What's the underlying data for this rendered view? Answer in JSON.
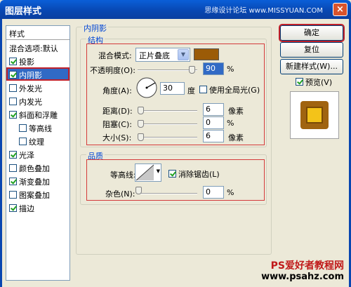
{
  "window": {
    "title": "图层样式",
    "watermark": "思缘设计论坛 www.MISSYUAN.COM",
    "close": "×"
  },
  "left": {
    "header": "样式",
    "items": [
      {
        "label": "混合选项:默认",
        "check": null,
        "sub": false,
        "sel": false
      },
      {
        "label": "投影",
        "check": true,
        "sub": false,
        "sel": false
      },
      {
        "label": "内阴影",
        "check": true,
        "sub": false,
        "sel": true
      },
      {
        "label": "外发光",
        "check": false,
        "sub": false,
        "sel": false
      },
      {
        "label": "内发光",
        "check": false,
        "sub": false,
        "sel": false
      },
      {
        "label": "斜面和浮雕",
        "check": true,
        "sub": false,
        "sel": false
      },
      {
        "label": "等高线",
        "check": false,
        "sub": true,
        "sel": false
      },
      {
        "label": "纹理",
        "check": false,
        "sub": true,
        "sel": false
      },
      {
        "label": "光泽",
        "check": true,
        "sub": false,
        "sel": false
      },
      {
        "label": "颜色叠加",
        "check": false,
        "sub": false,
        "sel": false
      },
      {
        "label": "渐变叠加",
        "check": true,
        "sub": false,
        "sel": false
      },
      {
        "label": "图案叠加",
        "check": false,
        "sub": false,
        "sel": false
      },
      {
        "label": "描边",
        "check": true,
        "sub": false,
        "sel": false
      }
    ]
  },
  "panel": {
    "title": "内阴影",
    "structure": {
      "title": "结构",
      "blend_mode_label": "混合模式:",
      "blend_mode_value": "正片叠底",
      "opacity_label": "不透明度(O):",
      "opacity_value": "90",
      "opacity_pct": 0.9,
      "angle_label": "角度(A):",
      "angle_value": "30",
      "angle_unit": "度",
      "global_light_label": "使用全局光(G)",
      "global_light_checked": false,
      "distance_label": "距离(D):",
      "distance_value": "6",
      "distance_unit": "像素",
      "choke_label": "阻塞(C):",
      "choke_value": "0",
      "size_label": "大小(S):",
      "size_value": "6",
      "size_unit": "像素",
      "percent": "%"
    },
    "quality": {
      "title": "品质",
      "contour_label": "等高线:",
      "antialias_label": "消除锯齿(L)",
      "antialias_checked": true,
      "noise_label": "杂色(N):",
      "noise_value": "0",
      "percent": "%"
    }
  },
  "buttons": {
    "ok": "确定",
    "reset": "复位",
    "new_style": "新建样式(W)...",
    "preview_label": "预览(V)"
  },
  "footer": {
    "line1": "PS爱好者教程网",
    "line2": "www.psahz.com"
  },
  "colors": {
    "shadow_color": "#9b5b07"
  }
}
